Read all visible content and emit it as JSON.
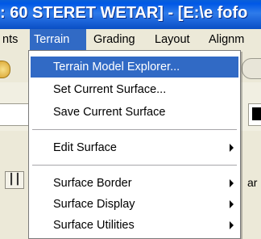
{
  "window": {
    "title": ": 60 STERET WETAR] - [E:\\e fofo"
  },
  "menubar": {
    "items": [
      {
        "label": "nts"
      },
      {
        "label": "Terrain"
      },
      {
        "label": "Grading"
      },
      {
        "label": "Layout"
      },
      {
        "label": "Alignm"
      }
    ],
    "active_color": "#316AC5"
  },
  "terrain_menu": {
    "items": [
      {
        "label": "Terrain Model Explorer...",
        "highlighted": true,
        "submenu": false
      },
      {
        "label": "Set Current Surface...",
        "highlighted": false,
        "submenu": false
      },
      {
        "label": "Save Current Surface",
        "highlighted": false,
        "submenu": false
      },
      {
        "label": "Edit Surface",
        "highlighted": false,
        "submenu": true
      },
      {
        "label": "Surface Border",
        "highlighted": false,
        "submenu": true
      },
      {
        "label": "Surface Display",
        "highlighted": false,
        "submenu": true
      },
      {
        "label": "Surface Utilities",
        "highlighted": false,
        "submenu": true
      }
    ]
  },
  "background": {
    "right_label": "ar"
  },
  "icons": {
    "left_toolbar": "yellow-circle-icon",
    "column_tool": "column-tool-icon",
    "submenu_arrow": "submenu-arrow-icon"
  }
}
